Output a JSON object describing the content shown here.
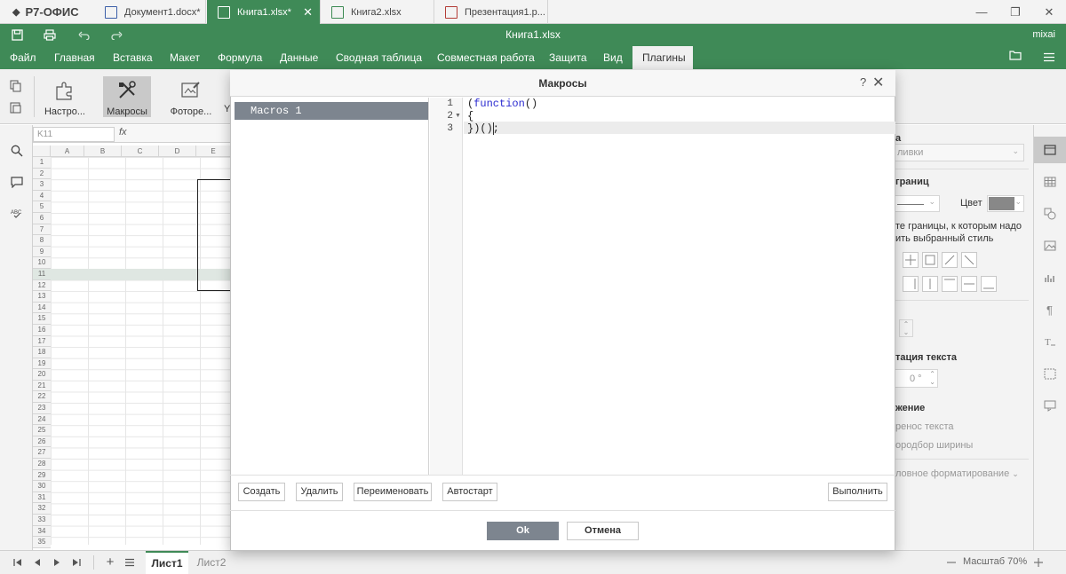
{
  "app": {
    "logo": "Р7-ОФИС"
  },
  "doc_tabs": [
    {
      "label": "Документ1.docx*",
      "close": ""
    },
    {
      "label": "Книга1.xlsx*",
      "close": "✕"
    },
    {
      "label": "Книга2.xlsx",
      "close": ""
    },
    {
      "label": "Презентация1.р...",
      "close": ""
    }
  ],
  "window": {
    "minimize": "—",
    "restore": "❐",
    "close": "✕"
  },
  "header": {
    "title": "Книга1.xlsx",
    "user": "mixai"
  },
  "menu": [
    "Файл",
    "Главная",
    "Вставка",
    "Макет",
    "Формула",
    "Данные",
    "Сводная таблица",
    "Совместная работа",
    "Защита",
    "Вид",
    "Плагины"
  ],
  "toolbar": {
    "settings": "Настро...",
    "macros": "Макросы",
    "photo": "Фоторе...",
    "more": "Y"
  },
  "formula": {
    "cellref": "K11",
    "fx": "fx"
  },
  "columns": [
    "A",
    "B",
    "C",
    "D",
    "E"
  ],
  "rows": [
    "1",
    "2",
    "3",
    "4",
    "5",
    "6",
    "7",
    "8",
    "9",
    "10",
    "11",
    "12",
    "13",
    "14",
    "15",
    "16",
    "17",
    "18",
    "19",
    "20",
    "21",
    "22",
    "23",
    "24",
    "25",
    "26",
    "27",
    "28",
    "29",
    "30",
    "31",
    "32",
    "33",
    "34",
    "35"
  ],
  "right_panel": {
    "fill_heading": "а",
    "fill_value": "ливки",
    "borders_heading": "границ",
    "color_label": "Цвет",
    "borders_hint1": "те границы, к которым надо",
    "borders_hint2": "ить выбранный стиль",
    "rotation_heading": "тация текста",
    "rotation_value": "0 °",
    "alignment_heading": "жение",
    "wrap": "ренос текста",
    "autofit": "ородбор ширины",
    "conditional": "ловное форматирование"
  },
  "status": {
    "sheet1": "Лист1",
    "sheet2": "Лист2",
    "zoom": "Масштаб 70%"
  },
  "dialog": {
    "title": "Макросы",
    "help": "?",
    "close": "✕",
    "macros": [
      "Macros 1"
    ],
    "code_lines": [
      "1",
      "2",
      "3"
    ],
    "code": {
      "l1_open": "(",
      "l1_kw": "function",
      "l1_close": "()",
      "l2": "{",
      "l3": "})();"
    },
    "buttons": {
      "create": "Создать",
      "delete": "Удалить",
      "rename": "Переименовать",
      "autostart": "Автостарт",
      "run": "Выполнить",
      "ok": "Ok",
      "cancel": "Отмена"
    }
  },
  "colors": {
    "accent": "#3f8a57",
    "selected": "#7d858f",
    "keyword": "#2a2ad0"
  }
}
